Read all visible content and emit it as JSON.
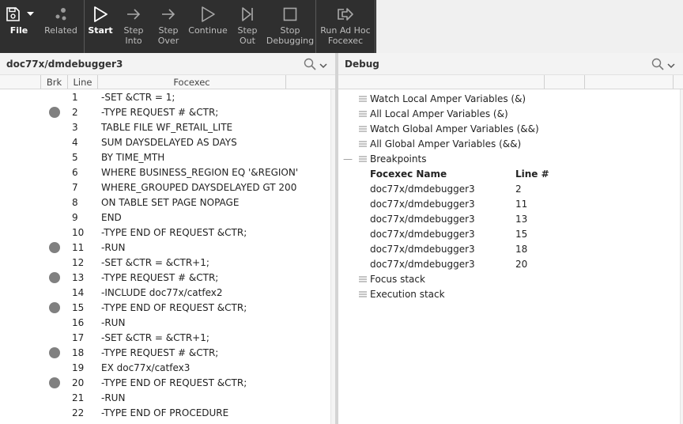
{
  "toolbar": {
    "file": "File",
    "related": "Related",
    "start": "Start",
    "step_into": [
      "Step",
      "Into"
    ],
    "step_over": [
      "Step",
      "Over"
    ],
    "continue": "Continue",
    "step_out": [
      "Step",
      "Out"
    ],
    "stop_debugging": [
      "Stop",
      "Debugging"
    ],
    "run_adhoc": [
      "Run Ad Hoc",
      "Focexec"
    ]
  },
  "left": {
    "title": "doc77x/dmdebugger3",
    "columns": [
      "Brk",
      "Line",
      "Focexec"
    ],
    "rows": [
      {
        "bp": false,
        "line": "1",
        "code": "-SET &CTR = 1;"
      },
      {
        "bp": true,
        "line": "2",
        "code": "-TYPE REQUEST # &CTR;"
      },
      {
        "bp": false,
        "line": "3",
        "code": "TABLE FILE WF_RETAIL_LITE"
      },
      {
        "bp": false,
        "line": "4",
        "code": "SUM DAYSDELAYED AS DAYS"
      },
      {
        "bp": false,
        "line": "5",
        "code": "BY TIME_MTH"
      },
      {
        "bp": false,
        "line": "6",
        "code": "WHERE BUSINESS_REGION EQ '&REGION'"
      },
      {
        "bp": false,
        "line": "7",
        "code": "WHERE_GROUPED DAYSDELAYED GT 200"
      },
      {
        "bp": false,
        "line": "8",
        "code": "ON TABLE SET PAGE NOPAGE"
      },
      {
        "bp": false,
        "line": "9",
        "code": "END"
      },
      {
        "bp": false,
        "line": "10",
        "code": "-TYPE END OF REQUEST &CTR;"
      },
      {
        "bp": true,
        "line": "11",
        "code": "-RUN"
      },
      {
        "bp": false,
        "line": "12",
        "code": "-SET &CTR = &CTR+1;"
      },
      {
        "bp": true,
        "line": "13",
        "code": "-TYPE REQUEST # &CTR;"
      },
      {
        "bp": false,
        "line": "14",
        "code": "-INCLUDE doc77x/catfex2"
      },
      {
        "bp": true,
        "line": "15",
        "code": "-TYPE END OF REQUEST &CTR;"
      },
      {
        "bp": false,
        "line": "16",
        "code": "-RUN"
      },
      {
        "bp": false,
        "line": "17",
        "code": "-SET &CTR = &CTR+1;"
      },
      {
        "bp": true,
        "line": "18",
        "code": "-TYPE REQUEST # &CTR;"
      },
      {
        "bp": false,
        "line": "19",
        "code": "EX doc77x/catfex3"
      },
      {
        "bp": true,
        "line": "20",
        "code": "-TYPE END OF REQUEST &CTR;"
      },
      {
        "bp": false,
        "line": "21",
        "code": "-RUN"
      },
      {
        "bp": false,
        "line": "22",
        "code": "-TYPE END OF PROCEDURE"
      }
    ]
  },
  "right": {
    "title": "Debug",
    "tree": {
      "watch_local": "Watch Local Amper Variables (&)",
      "all_local": "All Local Amper Variables (&)",
      "watch_global": "Watch Global Amper Variables (&&)",
      "all_global": "All Global Amper Variables (&&)",
      "breakpoints": "Breakpoints",
      "focus_stack": "Focus stack",
      "execution_stack": "Execution stack"
    },
    "bp_headers": {
      "name": "Focexec Name",
      "line": "Line #"
    },
    "bp_rows": [
      {
        "name": "doc77x/dmdebugger3",
        "line": "2"
      },
      {
        "name": "doc77x/dmdebugger3",
        "line": "11"
      },
      {
        "name": "doc77x/dmdebugger3",
        "line": "13"
      },
      {
        "name": "doc77x/dmdebugger3",
        "line": "15"
      },
      {
        "name": "doc77x/dmdebugger3",
        "line": "18"
      },
      {
        "name": "doc77x/dmdebugger3",
        "line": "20"
      }
    ],
    "collapse_glyph": "—"
  }
}
